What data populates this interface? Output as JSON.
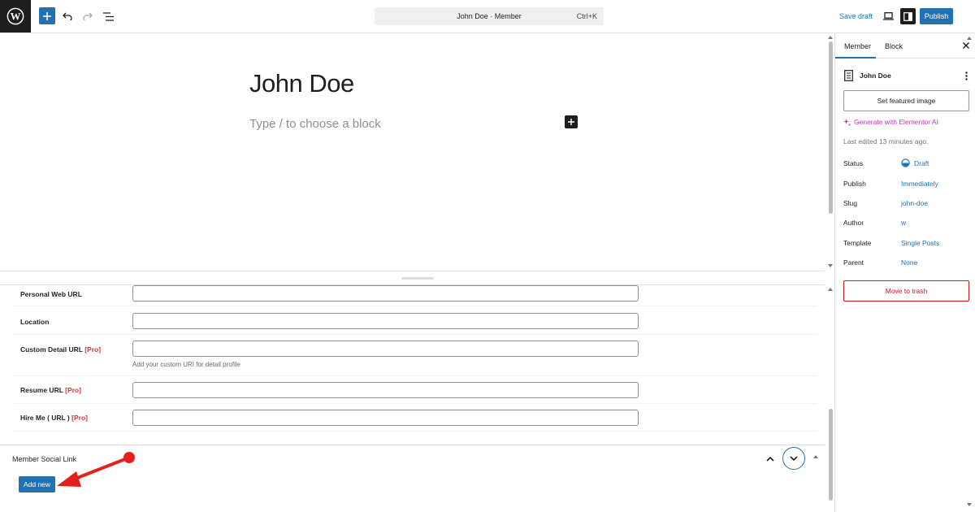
{
  "toolbar": {
    "command_title": "John Doe · Member",
    "command_shortcut": "Ctrl+K",
    "save_draft": "Save draft",
    "publish": "Publish",
    "icons": [
      "wordpress-logo-icon",
      "plus-icon",
      "undo-icon",
      "redo-icon",
      "document-overview-icon",
      "desktop-view-icon",
      "settings-panel-icon"
    ]
  },
  "editor": {
    "title": "John Doe",
    "block_placeholder": "Type / to choose a block"
  },
  "meta_fields": {
    "rows": [
      {
        "label": "Personal Web URL",
        "pro": "",
        "value": "",
        "help": ""
      },
      {
        "label": "Location",
        "pro": "",
        "value": "",
        "help": ""
      },
      {
        "label": "Custom Detail URL",
        "pro": "[Pro]",
        "value": "",
        "help": "Add your custom URI for detail profile"
      },
      {
        "label": "Resume URL",
        "pro": "[Pro]",
        "value": "",
        "help": ""
      },
      {
        "label": "Hire Me ( URL )",
        "pro": "[Pro]",
        "value": "",
        "help": ""
      }
    ],
    "social_box": {
      "title": "Member Social Link",
      "add_new": "Add new"
    }
  },
  "sidebar": {
    "tabs": [
      "Member",
      "Block"
    ],
    "active_tab": "Member",
    "doc_name": "John Doe",
    "featured_image": "Set featured image",
    "elementor_ai": "Generate with Elementor AI",
    "last_edited": "Last edited 13 minutes ago.",
    "props": [
      {
        "label": "Status",
        "value": "Draft"
      },
      {
        "label": "Publish",
        "value": "Immediately"
      },
      {
        "label": "Slug",
        "value": "john-doe"
      },
      {
        "label": "Author",
        "value": "w"
      },
      {
        "label": "Template",
        "value": "Single Posts"
      },
      {
        "label": "Parent",
        "value": "None"
      }
    ],
    "trash": "Move to trash"
  },
  "colors": {
    "accent": "#2271b1",
    "danger": "#cc1818",
    "pro": "#d63638",
    "elementor": "#c036c0",
    "annotation": "#e5201c"
  }
}
